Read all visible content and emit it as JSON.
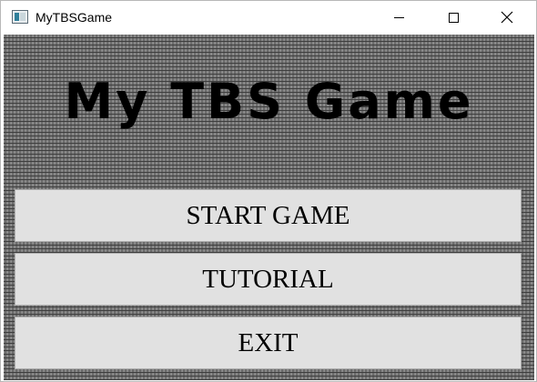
{
  "window": {
    "title": "MyTBSGame",
    "app_icon": "application-window-icon",
    "controls": [
      "minimize-icon",
      "maximize-icon",
      "close-icon"
    ]
  },
  "game": {
    "title": "My TBS Game",
    "background": "grey-brick-wall"
  },
  "menu": {
    "start_label": "START GAME",
    "tutorial_label": "TUTORIAL",
    "exit_label": "EXIT"
  },
  "colors": {
    "button_face": "#e1e1e1",
    "title_text": "#000000",
    "wall": "#7a7a7a"
  }
}
